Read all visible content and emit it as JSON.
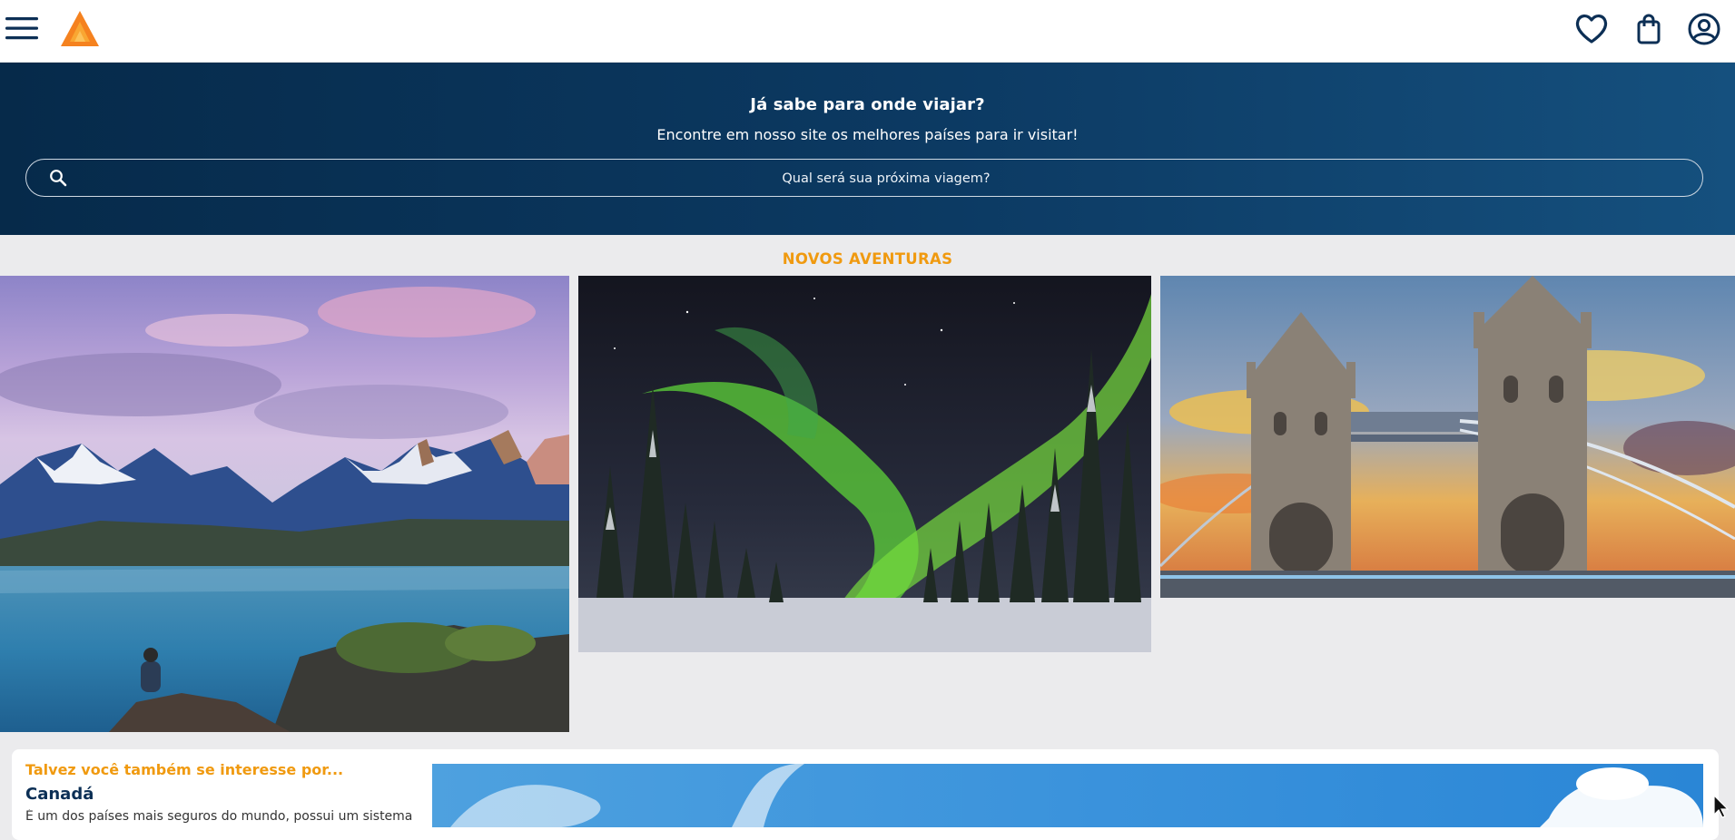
{
  "header": {
    "menu_icon": "hamburger-menu-icon",
    "logo_icon": "triangle-logo-icon",
    "actions": [
      {
        "icon": "heart-icon",
        "label": "Favoritos"
      },
      {
        "icon": "shopping-bag-icon",
        "label": "Carrinho"
      },
      {
        "icon": "user-account-icon",
        "label": "Conta"
      }
    ]
  },
  "hero": {
    "title": "Já sabe para onde viajar?",
    "subtitle": "Encontre em nosso site os melhores países para ir visitar!",
    "search": {
      "icon": "search-icon",
      "placeholder": "Qual será sua próxima viagem?",
      "value": ""
    }
  },
  "adventures": {
    "title": "NOVOS AVENTURAS",
    "items": [
      {
        "image": "mountain-lake-photo"
      },
      {
        "image": "northern-lights-photo"
      },
      {
        "image": "tower-bridge-photo"
      }
    ]
  },
  "suggestion": {
    "eyebrow": "Talvez você também se interesse por...",
    "country": "Canadá",
    "description": "É um dos países mais seguros do mundo, possui um sistema",
    "image": "canada-sky-photo"
  },
  "colors": {
    "brand_navy": "#0c3a63",
    "accent_orange": "#f09a10",
    "logo_orange": "#f5821f",
    "page_background": "#ebebed"
  }
}
